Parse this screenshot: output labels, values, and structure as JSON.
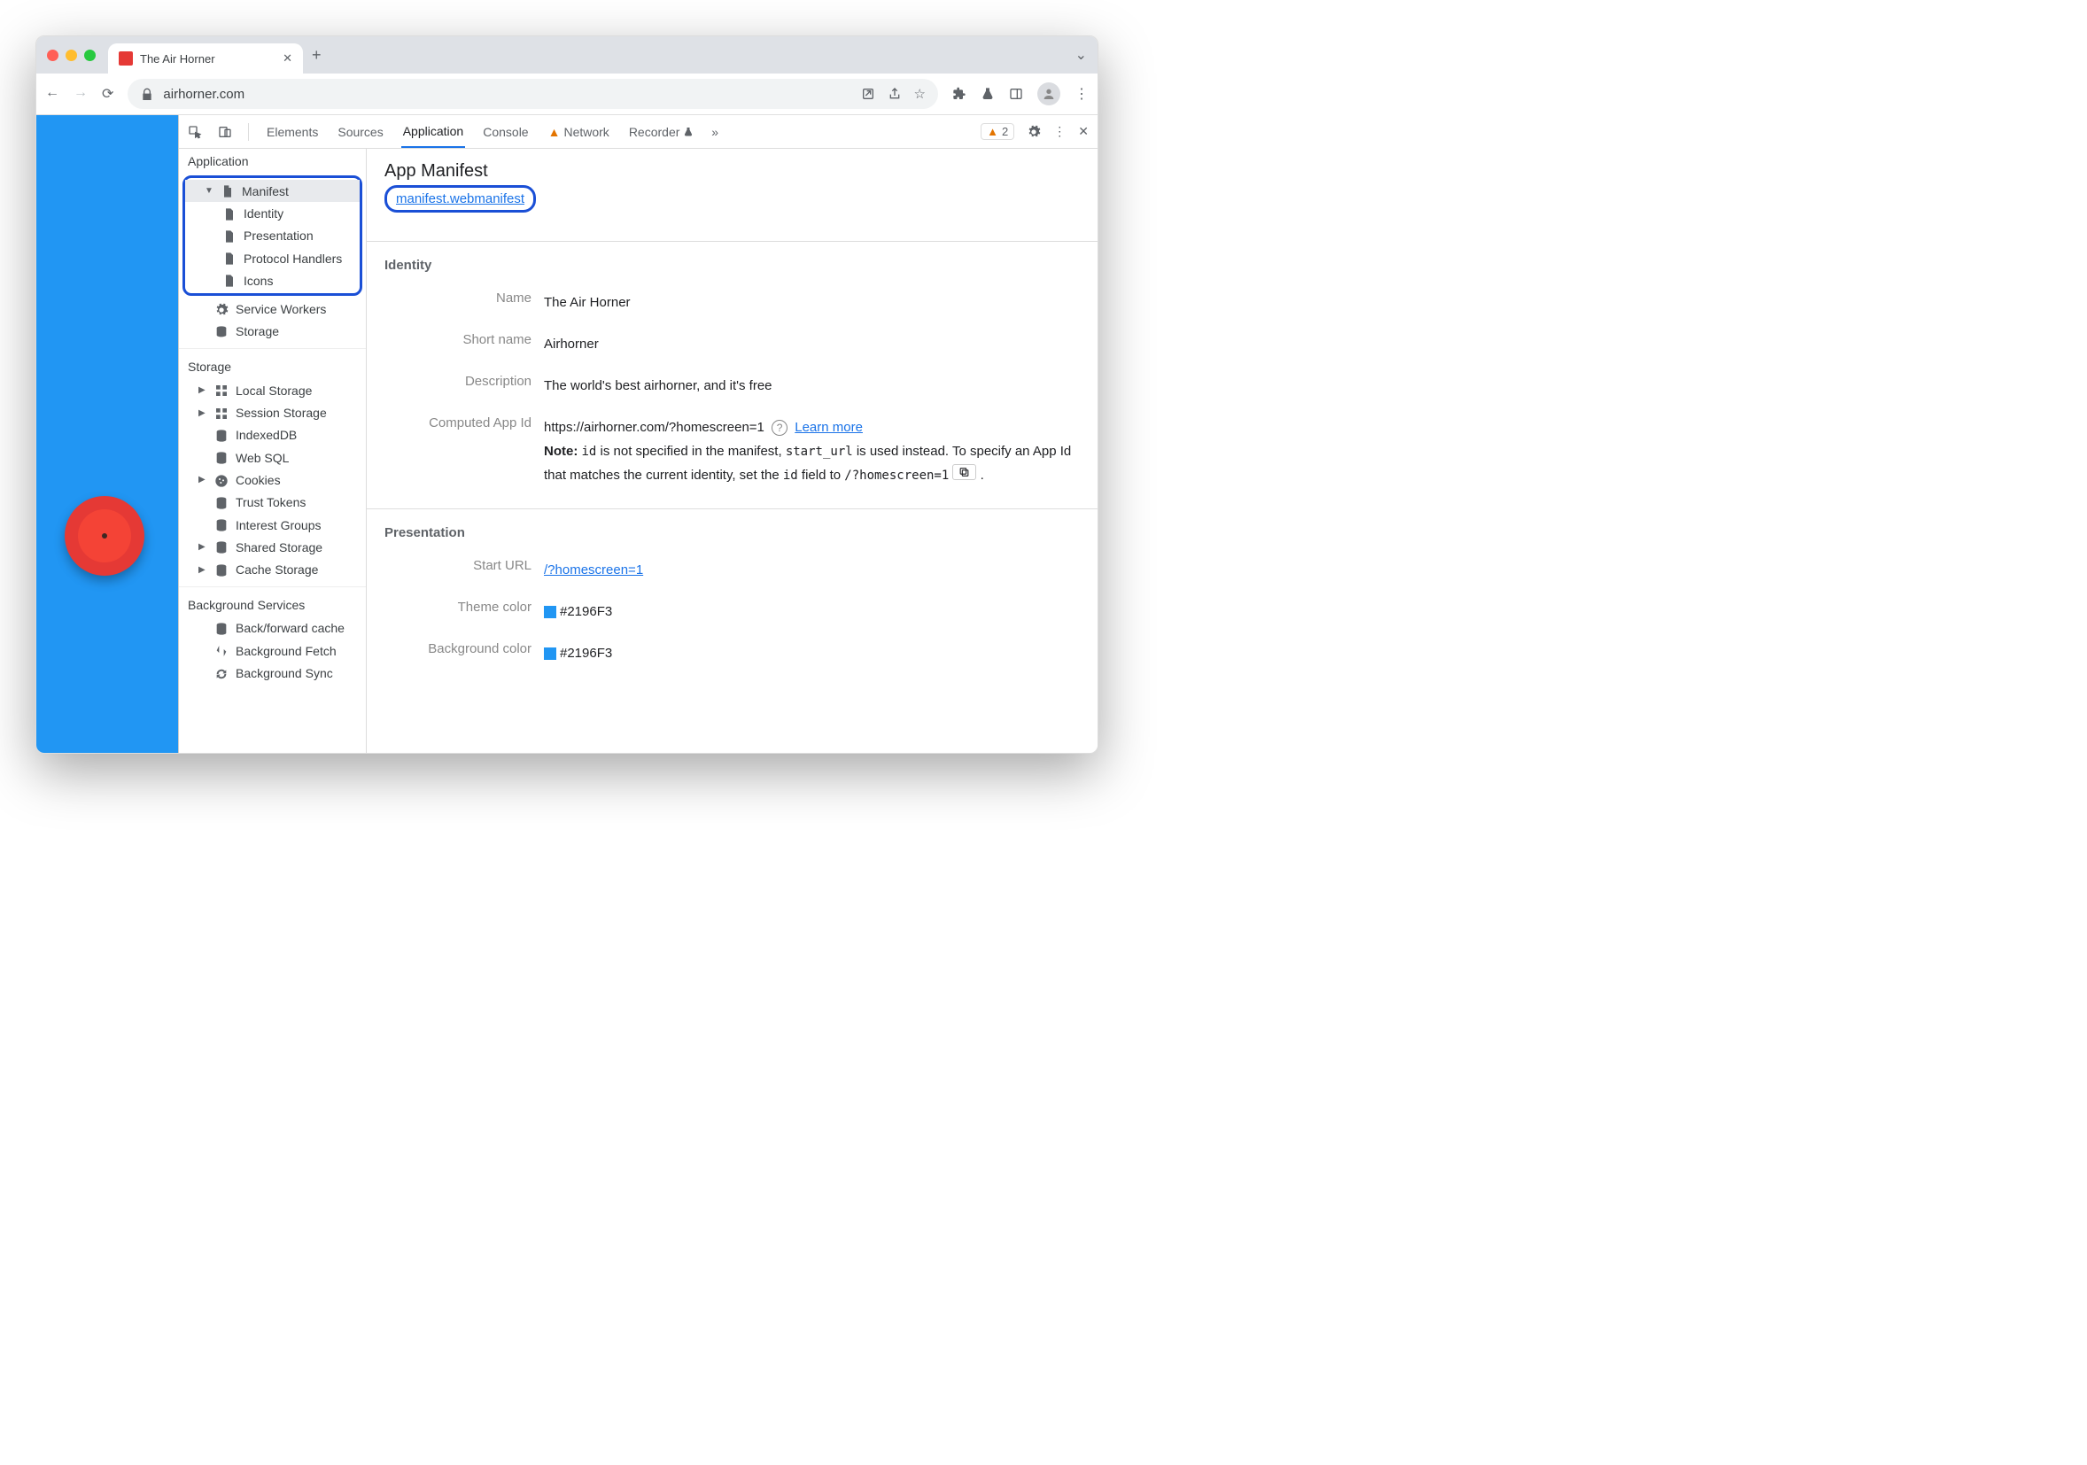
{
  "tab": {
    "title": "The Air Horner"
  },
  "url": "airhorner.com",
  "devtools": {
    "tabs": [
      "Elements",
      "Sources",
      "Application",
      "Console",
      "Network",
      "Recorder"
    ],
    "activeTab": "Application",
    "warnCount": "2"
  },
  "sidebar": {
    "applicationLabel": "Application",
    "items": {
      "manifest": "Manifest",
      "identity": "Identity",
      "presentation": "Presentation",
      "protocol": "Protocol Handlers",
      "icons": "Icons",
      "sw": "Service Workers",
      "storage": "Storage"
    },
    "storageLabel": "Storage",
    "storageItems": {
      "local": "Local Storage",
      "session": "Session Storage",
      "indexed": "IndexedDB",
      "websql": "Web SQL",
      "cookies": "Cookies",
      "trust": "Trust Tokens",
      "interest": "Interest Groups",
      "shared": "Shared Storage",
      "cache": "Cache Storage"
    },
    "bgLabel": "Background Services",
    "bgItems": {
      "bfcache": "Back/forward cache",
      "bgfetch": "Background Fetch",
      "bgsync": "Background Sync"
    }
  },
  "main": {
    "title": "App Manifest",
    "manifestLink": "manifest.webmanifest",
    "identity": {
      "heading": "Identity",
      "nameLabel": "Name",
      "nameValue": "The Air Horner",
      "shortLabel": "Short name",
      "shortValue": "Airhorner",
      "descLabel": "Description",
      "descValue": "The world's best airhorner, and it's free",
      "appIdLabel": "Computed App Id",
      "appIdValue": "https://airhorner.com/?homescreen=1",
      "learnMore": "Learn more",
      "noteLabel": "Note:",
      "noteText1": " is not specified in the manifest, ",
      "noteText2": " is used instead. To specify an App Id that matches the current identity, set the ",
      "noteText3": " field to ",
      "code_id": "id",
      "code_starturl": "start_url",
      "code_suggest": "/?homescreen=1",
      "period": "."
    },
    "presentation": {
      "heading": "Presentation",
      "startLabel": "Start URL",
      "startValue": "/?homescreen=1",
      "themeLabel": "Theme color",
      "themeValue": "#2196F3",
      "bgLabel": "Background color",
      "bgValue": "#2196F3"
    }
  }
}
